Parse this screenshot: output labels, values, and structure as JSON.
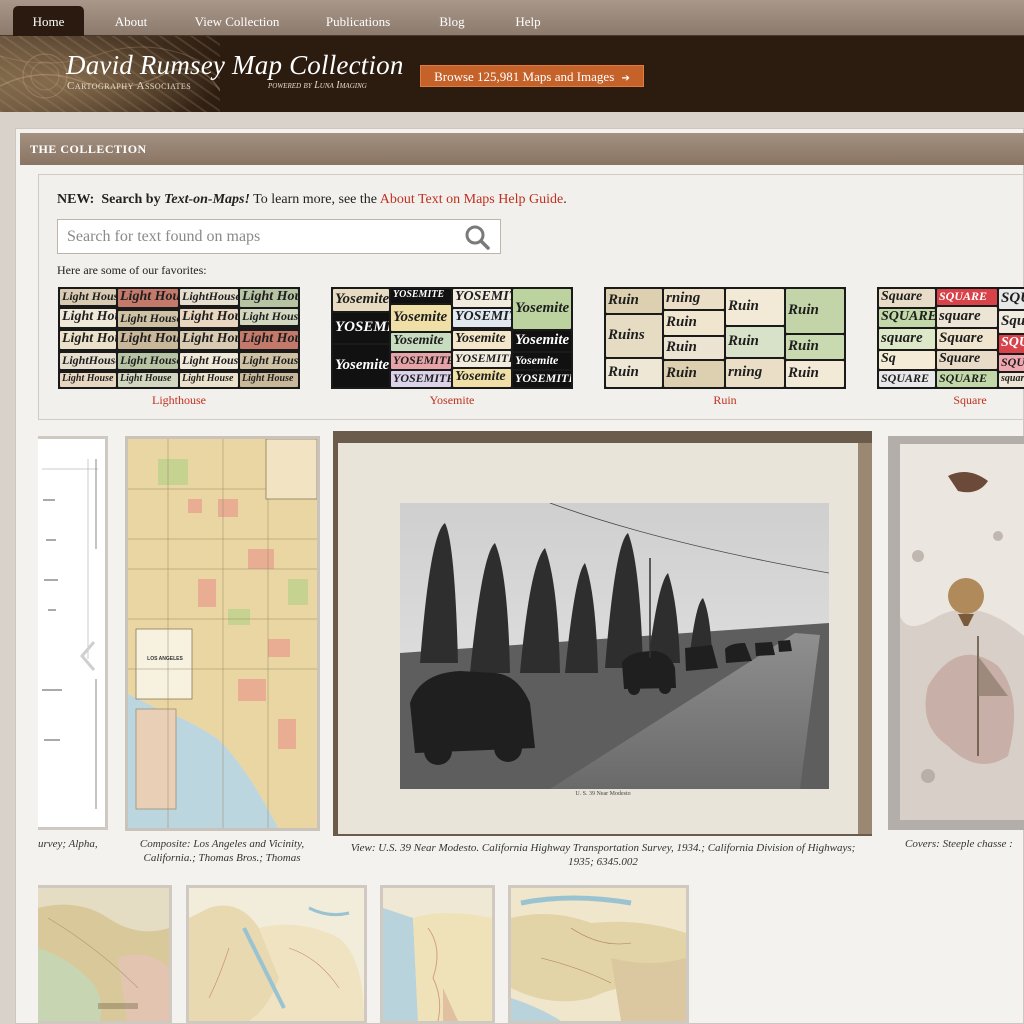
{
  "nav": {
    "items": [
      {
        "label": "Home",
        "active": true
      },
      {
        "label": "About",
        "active": false
      },
      {
        "label": "View Collection",
        "active": false
      },
      {
        "label": "Publications",
        "active": false
      },
      {
        "label": "Blog",
        "active": false
      },
      {
        "label": "Help",
        "active": false
      }
    ]
  },
  "banner": {
    "title": "David Rumsey Map Collection",
    "subtitle": "Cartography Associates",
    "powered": "powered by Luna Imaging",
    "browse_button": "Browse 125,981 Maps and Images",
    "browse_arrow": "➔"
  },
  "section": {
    "title": "THE COLLECTION"
  },
  "text_on_maps": {
    "new_label": "NEW:",
    "search_by": "Search by",
    "feature_name": "Text-on-Maps!",
    "learn_more": "To learn more, see the",
    "guide_link": "About Text on Maps Help Guide",
    "period": ".",
    "search_placeholder": "Search for text found on maps",
    "favorites_label": "Here are some of our favorites:",
    "favorites": [
      {
        "label": "Lighthouse",
        "tile_words": [
          "Light House",
          "Light House",
          "LightHouse",
          "Light House",
          "Light House",
          "Light House",
          "Light House",
          "Light House",
          "Light House",
          "Light House"
        ]
      },
      {
        "label": "Yosemite",
        "tile_words": [
          "Yosemite",
          "YOSEMITE",
          "YOSEMITE",
          "Yosemite",
          "YOSEMITE",
          "Yosemite",
          "YOSEMITE",
          "Yosemite",
          "Yosemite",
          "Yosemite"
        ]
      },
      {
        "label": "Ruin",
        "tile_words": [
          "Ruin",
          "rning",
          "Ruin",
          "Ruin",
          "Ruins",
          "Ruin",
          "Ruin",
          "Ruin",
          "Ruin",
          "Ruin"
        ]
      },
      {
        "label": "Square",
        "tile_words": [
          "Square",
          "SQUARE",
          "SQUARE",
          "SQUARE",
          "square",
          "Square",
          "square",
          "Square",
          "SQUARE",
          "Sq"
        ]
      }
    ]
  },
  "carousel": {
    "items": [
      {
        "caption": "urvey; Alpha,"
      },
      {
        "caption": "Composite: Los Angeles and Vicinity, California.; Thomas Bros.; Thomas"
      },
      {
        "caption": "View: U.S. 39 Near Modesto. California Highway Transportation Survey, 1934.; California Division of Highways; 1935; 6345.002",
        "photo_caption": "U. S. 39 Near Modesto"
      },
      {
        "caption": "Covers: Steeple chasse :"
      }
    ],
    "la_map_label": "LOS ANGELES"
  },
  "colors": {
    "accent": "#c0301f",
    "button": "#c5622a",
    "banner_bg": "#2c1c10",
    "nav_bg": "#8c7a6d"
  }
}
